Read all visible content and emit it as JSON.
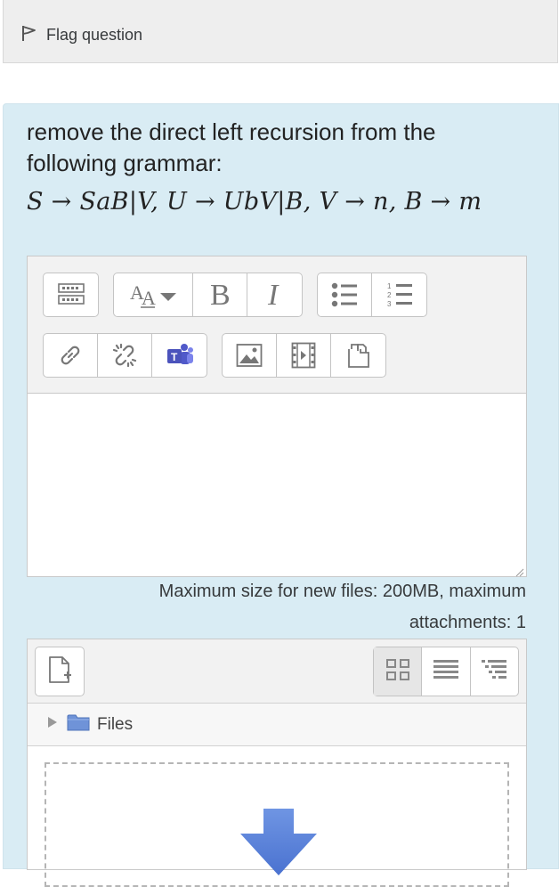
{
  "flag": {
    "label": "Flag question",
    "icon": "flag-icon"
  },
  "question": {
    "text": "remove the direct left recursion from the following grammar:",
    "formula": "S → SaB|V, U → UbV|B, V → n, B → m"
  },
  "editor": {
    "toolbar_row1": [
      {
        "icon": "toolbar-toggle-icon"
      },
      {
        "icon": "font-size-icon"
      },
      {
        "icon": "bold-icon"
      },
      {
        "icon": "italic-icon"
      },
      {
        "icon": "unordered-list-icon"
      },
      {
        "icon": "ordered-list-icon"
      }
    ],
    "toolbar_row2": [
      {
        "icon": "link-icon"
      },
      {
        "icon": "unlink-icon"
      },
      {
        "icon": "teams-icon"
      },
      {
        "icon": "image-icon"
      },
      {
        "icon": "media-icon"
      },
      {
        "icon": "manage-files-icon"
      }
    ],
    "textarea_value": ""
  },
  "files": {
    "max_info": "Maximum size for new files: 200MB, maximum attachments: 1",
    "path_label": "Files",
    "view_modes": [
      "icons",
      "list",
      "tree"
    ],
    "active_view": "icons"
  },
  "colors": {
    "question_bg": "#d9ecf4",
    "flag_bar_bg": "#eeeeee",
    "folder_blue": "#6f93d8",
    "arrow_blue": "#5b82d9"
  }
}
